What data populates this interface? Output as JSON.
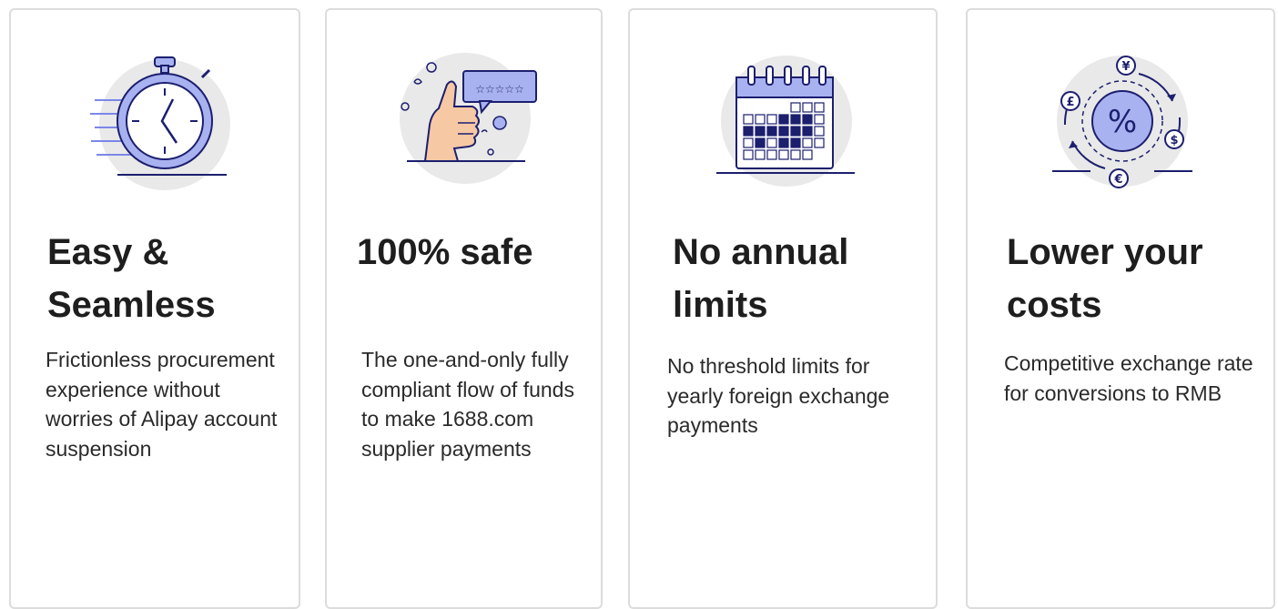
{
  "cards": [
    {
      "icon": "stopwatch-icon",
      "title": "Easy & Seamless",
      "description": "Frictionless procurement experience without worries of Alipay account suspension"
    },
    {
      "icon": "thumbs-up-rating-icon",
      "title": "100% safe",
      "description": "The one-and-only fully compliant flow of funds to make 1688.com supplier payments"
    },
    {
      "icon": "calendar-icon",
      "title": "No annual limits",
      "description": "No threshold limits for yearly foreign exchange payments"
    },
    {
      "icon": "currency-exchange-icon",
      "title": "Lower your costs",
      "description": "Competitive exchange rate for conversions to RMB"
    }
  ],
  "colors": {
    "accent": "#7b87e8",
    "accent_light": "#a9b2f0",
    "navy": "#1c1f6e",
    "circle_bg": "#e9e9e9",
    "skin": "#f7c8a4"
  },
  "currency_symbols": {
    "yen": "¥",
    "pound": "£",
    "dollar": "$",
    "euro": "€",
    "percent": "%"
  }
}
